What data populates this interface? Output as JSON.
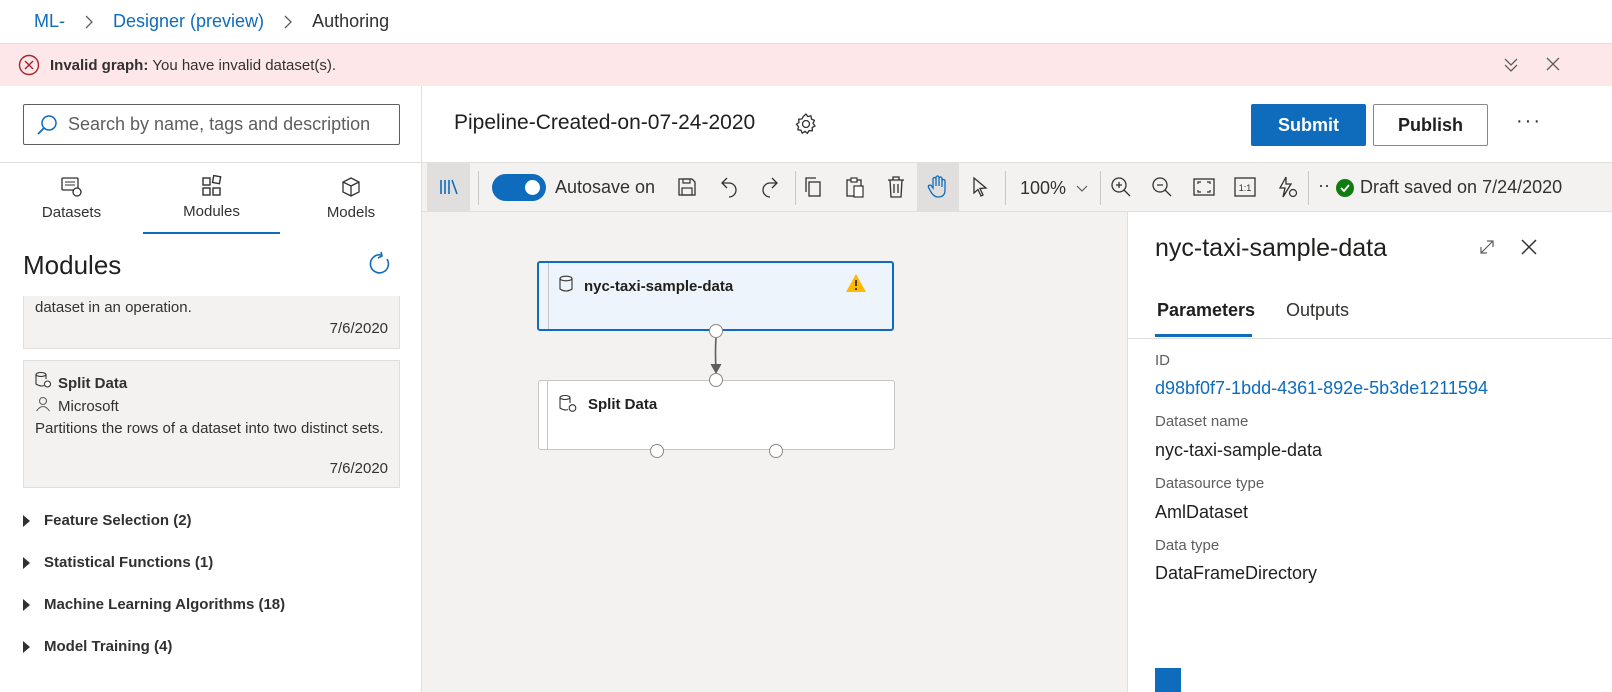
{
  "breadcrumb": {
    "workspace": "ML-",
    "designer": "Designer (preview)",
    "current": "Authoring"
  },
  "banner": {
    "title": "Invalid graph:",
    "message": "You have invalid dataset(s)."
  },
  "left_panel": {
    "search_placeholder": "Search by name, tags and description",
    "tabs": [
      {
        "label": "Datasets"
      },
      {
        "label": "Modules"
      },
      {
        "label": "Models"
      }
    ],
    "active_tab": "Modules",
    "heading": "Modules",
    "cards": [
      {
        "description": "dataset in an operation.",
        "date": "7/6/2020"
      },
      {
        "title": "Split Data",
        "author": "Microsoft",
        "description": "Partitions the rows of a dataset into two distinct sets.",
        "date": "7/6/2020"
      }
    ],
    "categories": [
      {
        "label": "Feature Selection (2)"
      },
      {
        "label": "Statistical Functions (1)"
      },
      {
        "label": "Machine Learning Algorithms (18)"
      },
      {
        "label": "Model Training (4)"
      }
    ]
  },
  "header": {
    "pipeline_title": "Pipeline-Created-on-07-24-2020",
    "submit_label": "Submit",
    "publish_label": "Publish",
    "more_label": "···"
  },
  "toolbar": {
    "autosave_label": "Autosave on",
    "autosave_on": true,
    "zoom": "100%",
    "draft_status": "Draft saved on 7/24/2020",
    "overflow_label": "··"
  },
  "canvas": {
    "nodes": [
      {
        "label": "nyc-taxi-sample-data",
        "warning": true,
        "selected": true
      },
      {
        "label": "Split Data"
      }
    ]
  },
  "properties": {
    "title": "nyc-taxi-sample-data",
    "tabs": [
      {
        "label": "Parameters"
      },
      {
        "label": "Outputs"
      }
    ],
    "active_tab": "Parameters",
    "fields": [
      {
        "label": "ID",
        "value": "d98bf0f7-1bdd-4361-892e-5b3de1211594",
        "is_link": true
      },
      {
        "label": "Dataset name",
        "value": "nyc-taxi-sample-data"
      },
      {
        "label": "Datasource type",
        "value": "AmlDataset"
      },
      {
        "label": "Data type",
        "value": "DataFrameDirectory"
      }
    ]
  },
  "colors": {
    "accent": "#0f6cbd",
    "error_bg": "#fde7e9",
    "error": "#a4262c",
    "warning": "#ffb900",
    "success": "#107c10"
  }
}
